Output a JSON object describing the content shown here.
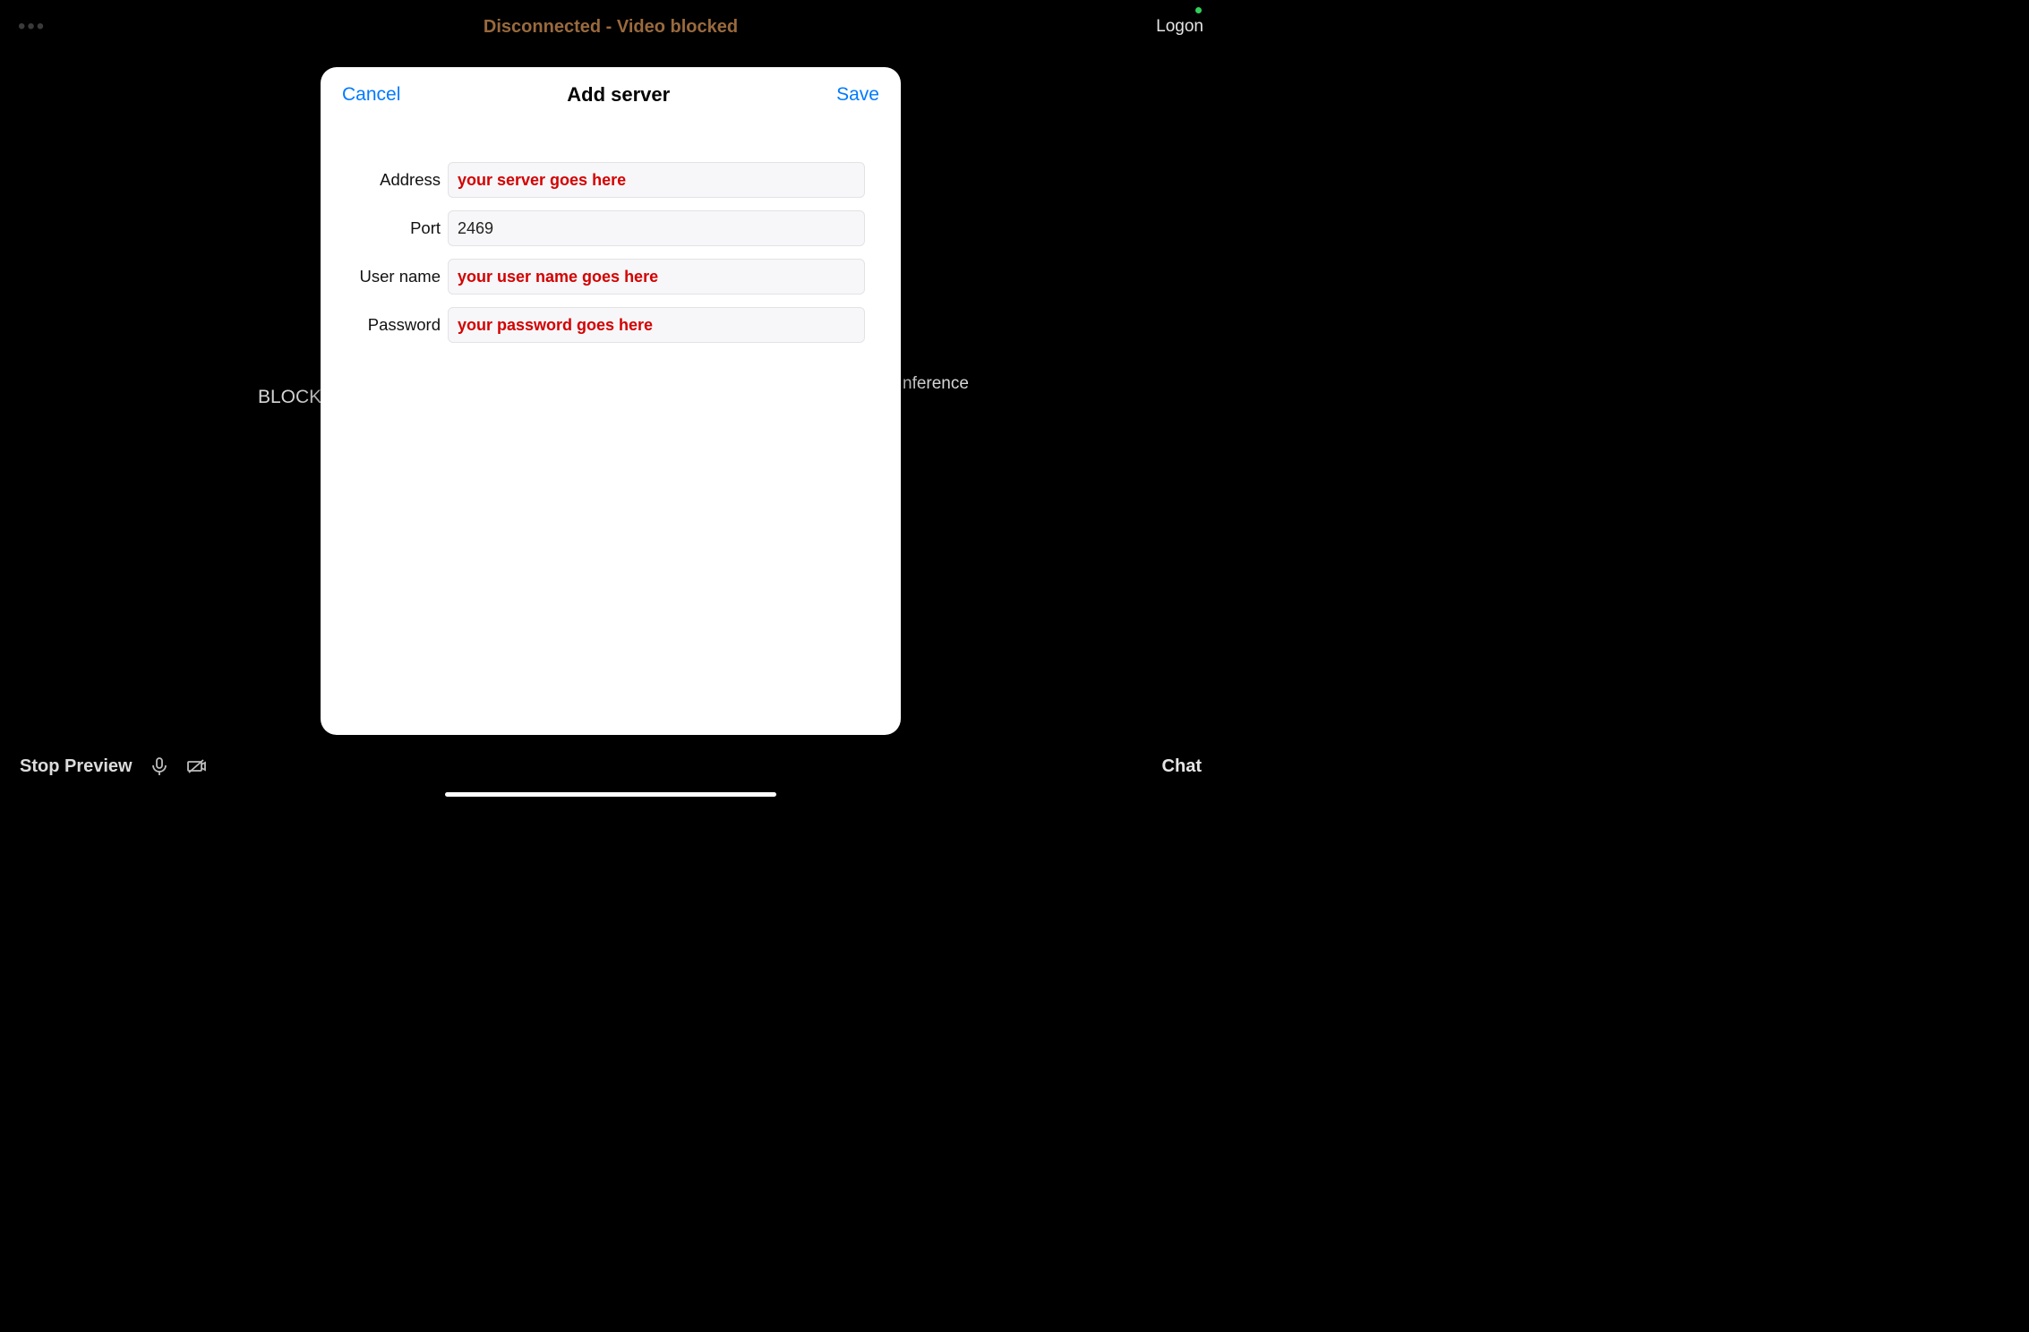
{
  "status_dot": true,
  "top": {
    "title": "Disconnected - Video blocked",
    "logon": "Logon"
  },
  "background": {
    "blocked": "BLOCKED",
    "conference": "nference"
  },
  "bottom": {
    "stop_preview": "Stop Preview",
    "chat": "Chat"
  },
  "modal": {
    "cancel": "Cancel",
    "title": "Add server",
    "save": "Save",
    "fields": {
      "address": {
        "label": "Address",
        "value": "your server goes here"
      },
      "port": {
        "label": "Port",
        "value": "2469"
      },
      "username": {
        "label": "User name",
        "value": "your user name goes here"
      },
      "password": {
        "label": "Password",
        "value": "your password goes here"
      }
    }
  },
  "colors": {
    "accent_link": "#007aff",
    "warning_title": "#9a6a3d",
    "annotation_red": "#d40000"
  }
}
